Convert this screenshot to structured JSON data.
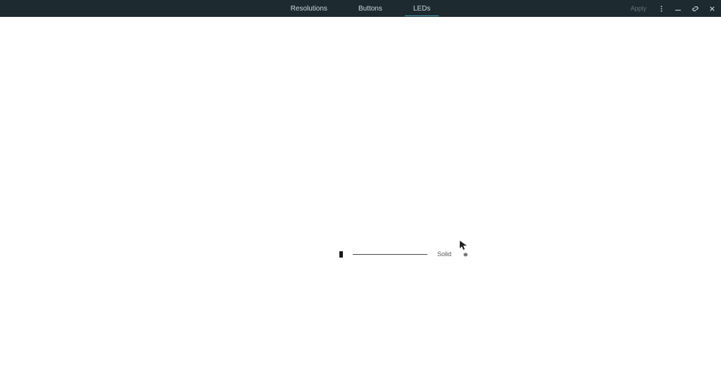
{
  "header": {
    "tabs": [
      {
        "label": "Resolutions",
        "active": false
      },
      {
        "label": "Buttons",
        "active": false
      },
      {
        "label": "LEDs",
        "active": true
      }
    ],
    "apply_label": "Apply"
  },
  "led": {
    "mode_label": "Solid",
    "swatch_color": "#1a1a1a"
  }
}
